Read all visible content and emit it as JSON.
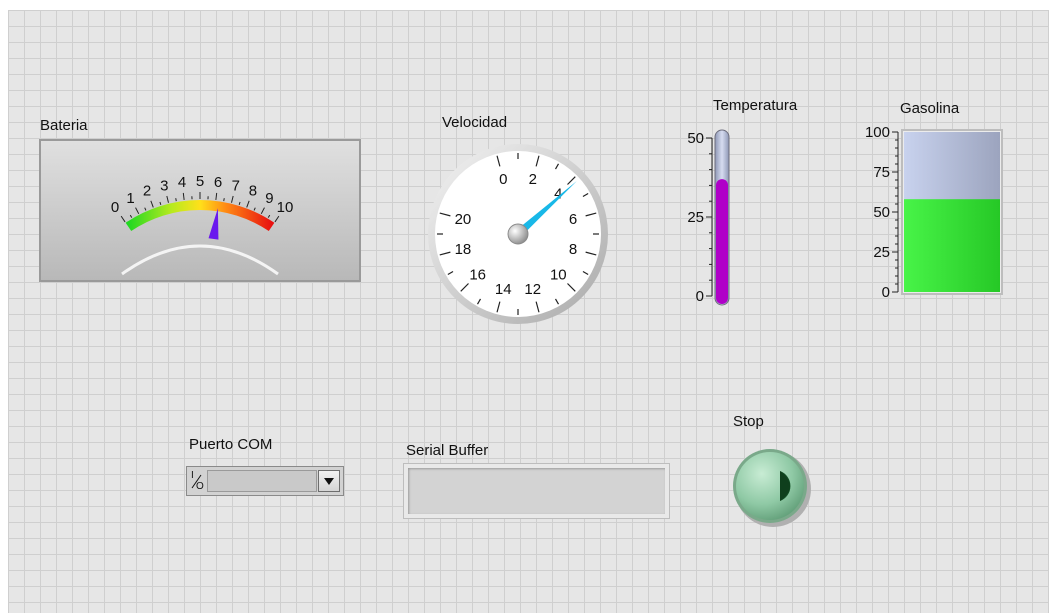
{
  "labels": {
    "bateria": "Bateria",
    "velocidad": "Velocidad",
    "temperatura": "Temperatura",
    "gasolina": "Gasolina",
    "puerto_com": "Puerto COM",
    "serial_buffer": "Serial Buffer",
    "stop": "Stop"
  },
  "bateria": {
    "ticks": [
      "0",
      "1",
      "2",
      "3",
      "4",
      "5",
      "6",
      "7",
      "8",
      "9",
      "10"
    ],
    "min": 0,
    "max": 10,
    "value": 6.2
  },
  "velocidad": {
    "ticks": [
      "0",
      "2",
      "4",
      "6",
      "8",
      "10",
      "12",
      "14",
      "16",
      "18",
      "20"
    ],
    "min": 0,
    "max": 20,
    "value": 4.2
  },
  "temperatura": {
    "ticks": [
      "50",
      "25",
      "0"
    ],
    "min": 0,
    "max": 50,
    "value": 37,
    "fill_color": "#b000c8"
  },
  "gasolina": {
    "ticks": [
      "100",
      "75",
      "50",
      "25",
      "0"
    ],
    "min": 0,
    "max": 100,
    "value": 58,
    "fill_color": "#3fe23f"
  },
  "puerto_com": {
    "io_icon": "I/O",
    "value": ""
  },
  "serial_buffer": {
    "value": ""
  },
  "stop": {
    "icon": "play-triangle-icon",
    "color": "#8fc9a5"
  }
}
